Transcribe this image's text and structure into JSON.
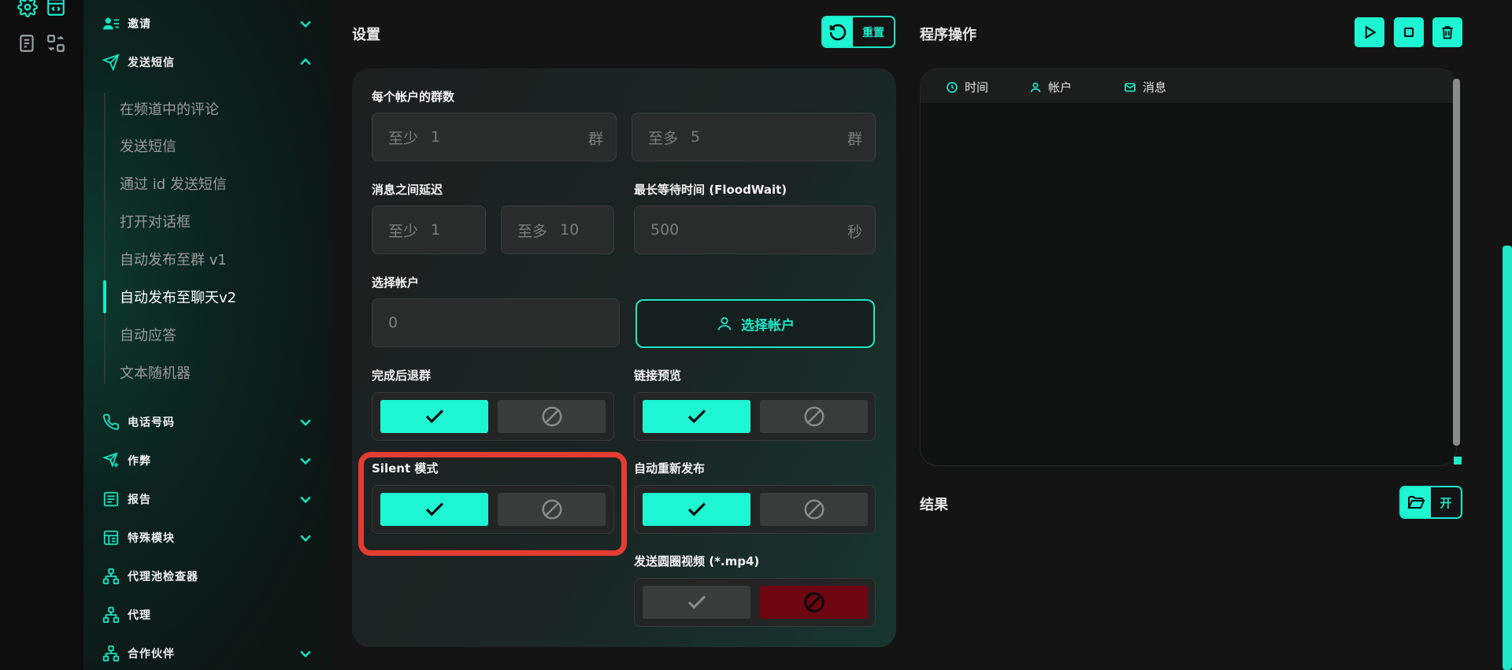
{
  "rail": {
    "icons": [
      "gear-icon",
      "code-window-icon",
      "document-list-icon",
      "switch-icon"
    ]
  },
  "sidebar": {
    "items_top": [
      {
        "label": "邀请",
        "icon": "user-list-icon",
        "expanded": false
      },
      {
        "label": "发送短信",
        "icon": "send-icon",
        "expanded": true
      }
    ],
    "sub_items": [
      {
        "label": "在频道中的评论",
        "active": false
      },
      {
        "label": "发送短信",
        "active": false
      },
      {
        "label": "通过 id 发送短信",
        "active": false
      },
      {
        "label": "打开对话框",
        "active": false
      },
      {
        "label": "自动发布至群 v1",
        "active": false
      },
      {
        "label": "自动发布至聊天v2",
        "active": true
      },
      {
        "label": "自动应答",
        "active": false
      },
      {
        "label": "文本随机器",
        "active": false
      }
    ],
    "items_bottom": [
      {
        "label": "电话号码",
        "icon": "phone-icon",
        "has_chevron": true
      },
      {
        "label": "作弊",
        "icon": "send-plus-icon",
        "has_chevron": true
      },
      {
        "label": "报告",
        "icon": "report-icon",
        "has_chevron": true
      },
      {
        "label": "特殊模块",
        "icon": "module-icon",
        "has_chevron": true
      },
      {
        "label": "代理池检查器",
        "icon": "network-icon",
        "has_chevron": false
      },
      {
        "label": "代理",
        "icon": "network-icon",
        "has_chevron": false
      },
      {
        "label": "合作伙伴",
        "icon": "network-icon",
        "has_chevron": true
      }
    ]
  },
  "settings": {
    "title": "设置",
    "reset_label": "重置",
    "groups_per_account": {
      "label": "每个帐户的群数",
      "min_prefix": "至少",
      "min_value": "1",
      "min_suffix": "群",
      "max_prefix": "至多",
      "max_value": "5",
      "max_suffix": "群"
    },
    "delay": {
      "label": "消息之间延迟",
      "min_prefix": "至少",
      "min_value": "1",
      "max_prefix": "至多",
      "max_value": "10"
    },
    "flood_wait": {
      "label": "最长等待时间 (FloodWait)",
      "value": "500",
      "suffix": "秒"
    },
    "select_accounts": {
      "label": "选择帐户",
      "value": "0",
      "button_label": "选择帐户"
    },
    "leave_after": {
      "label": "完成后退群",
      "state": "on"
    },
    "link_preview": {
      "label": "链接预览",
      "state": "on"
    },
    "silent_mode": {
      "label": "Silent 模式",
      "state": "on"
    },
    "auto_repost": {
      "label": "自动重新发布",
      "state": "on"
    },
    "send_circle_video": {
      "label": "发送圆圈视频 (*.mp4)",
      "state": "off"
    }
  },
  "operations": {
    "title": "程序操作",
    "buttons": [
      "play-icon",
      "stop-icon",
      "trash-icon"
    ],
    "log_columns": [
      {
        "label": "时间",
        "icon": "clock-icon"
      },
      {
        "label": "帐户",
        "icon": "user-icon"
      },
      {
        "label": "消息",
        "icon": "mail-icon"
      }
    ]
  },
  "results": {
    "title": "结果",
    "open_label": "开"
  },
  "colors": {
    "accent": "#1DF5D3",
    "highlight": "#E43C32",
    "danger": "#6E0612"
  }
}
